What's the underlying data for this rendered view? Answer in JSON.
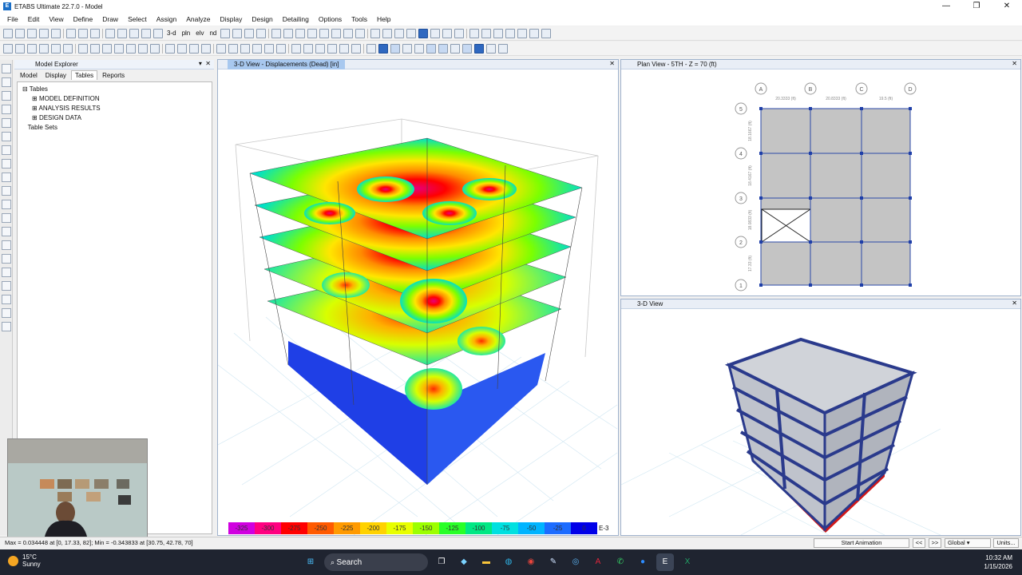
{
  "app": {
    "title": "ETABS Ultimate 22.7.0 - Model",
    "icon_letter": "E",
    "window_controls": [
      "—",
      "❐",
      "✕"
    ]
  },
  "menu": [
    "File",
    "Edit",
    "View",
    "Define",
    "Draw",
    "Select",
    "Assign",
    "Analyze",
    "Display",
    "Design",
    "Detailing",
    "Options",
    "Tools",
    "Help"
  ],
  "toolbar": {
    "view_3d_label": "3-d",
    "plan_label": "pln",
    "elev_label": "elv",
    "nd_label": "nd"
  },
  "explorer": {
    "title": "Model Explorer",
    "tabs": [
      "Model",
      "Display",
      "Tables",
      "Reports"
    ],
    "active_tab": "Tables",
    "tree": {
      "root": "Tables",
      "children": [
        "MODEL DEFINITION",
        "ANALYSIS RESULTS",
        "DESIGN DATA"
      ],
      "sibling": "Table Sets"
    }
  },
  "view_main": {
    "title": "3-D View  - Displacements (Dead)  [in]",
    "scale_labels": [
      "-325",
      "-300",
      "-275",
      "-250",
      "-225",
      "-200",
      "-175",
      "-150",
      "-125",
      "-100",
      "-75",
      "-50",
      "-25",
      "0"
    ],
    "scale_colors": [
      "#d000e0",
      "#ff0080",
      "#ff0000",
      "#ff5a00",
      "#ff9a00",
      "#ffd200",
      "#e8ff00",
      "#9cff00",
      "#28ff28",
      "#00e884",
      "#00e0e0",
      "#00b4ff",
      "#1c6cff",
      "#0000e8"
    ],
    "scale_suffix": "E-3"
  },
  "view_plan": {
    "title": "Plan View - 5TH - Z = 70 (ft)",
    "grid_x": [
      "A",
      "B",
      "C",
      "D"
    ],
    "grid_y": [
      "5",
      "4",
      "3",
      "2",
      "1"
    ],
    "dims_x": [
      "20.3333 (ft)",
      "20.8333 (ft)",
      "19.5 (ft)"
    ],
    "dims_y": [
      "18.1667 (ft)",
      "18.4167 (ft)",
      "18.0833 (ft)",
      "17.33 (ft)"
    ]
  },
  "view_3d_small": {
    "title": "3-D View"
  },
  "status": {
    "message": "Max = 0.034448 at [0, 17.33, 82];  Min = -0.343833 at [30.75, 42.78, 70]",
    "animation_label": "Start Animation",
    "prev": "<<",
    "next": ">>",
    "coord_system": "Global",
    "units": "Units..."
  },
  "taskbar": {
    "weather_temp": "15°C",
    "weather_desc": "Sunny",
    "search_label": "Search",
    "time": "10:32 AM",
    "date": "1/15/2026"
  }
}
